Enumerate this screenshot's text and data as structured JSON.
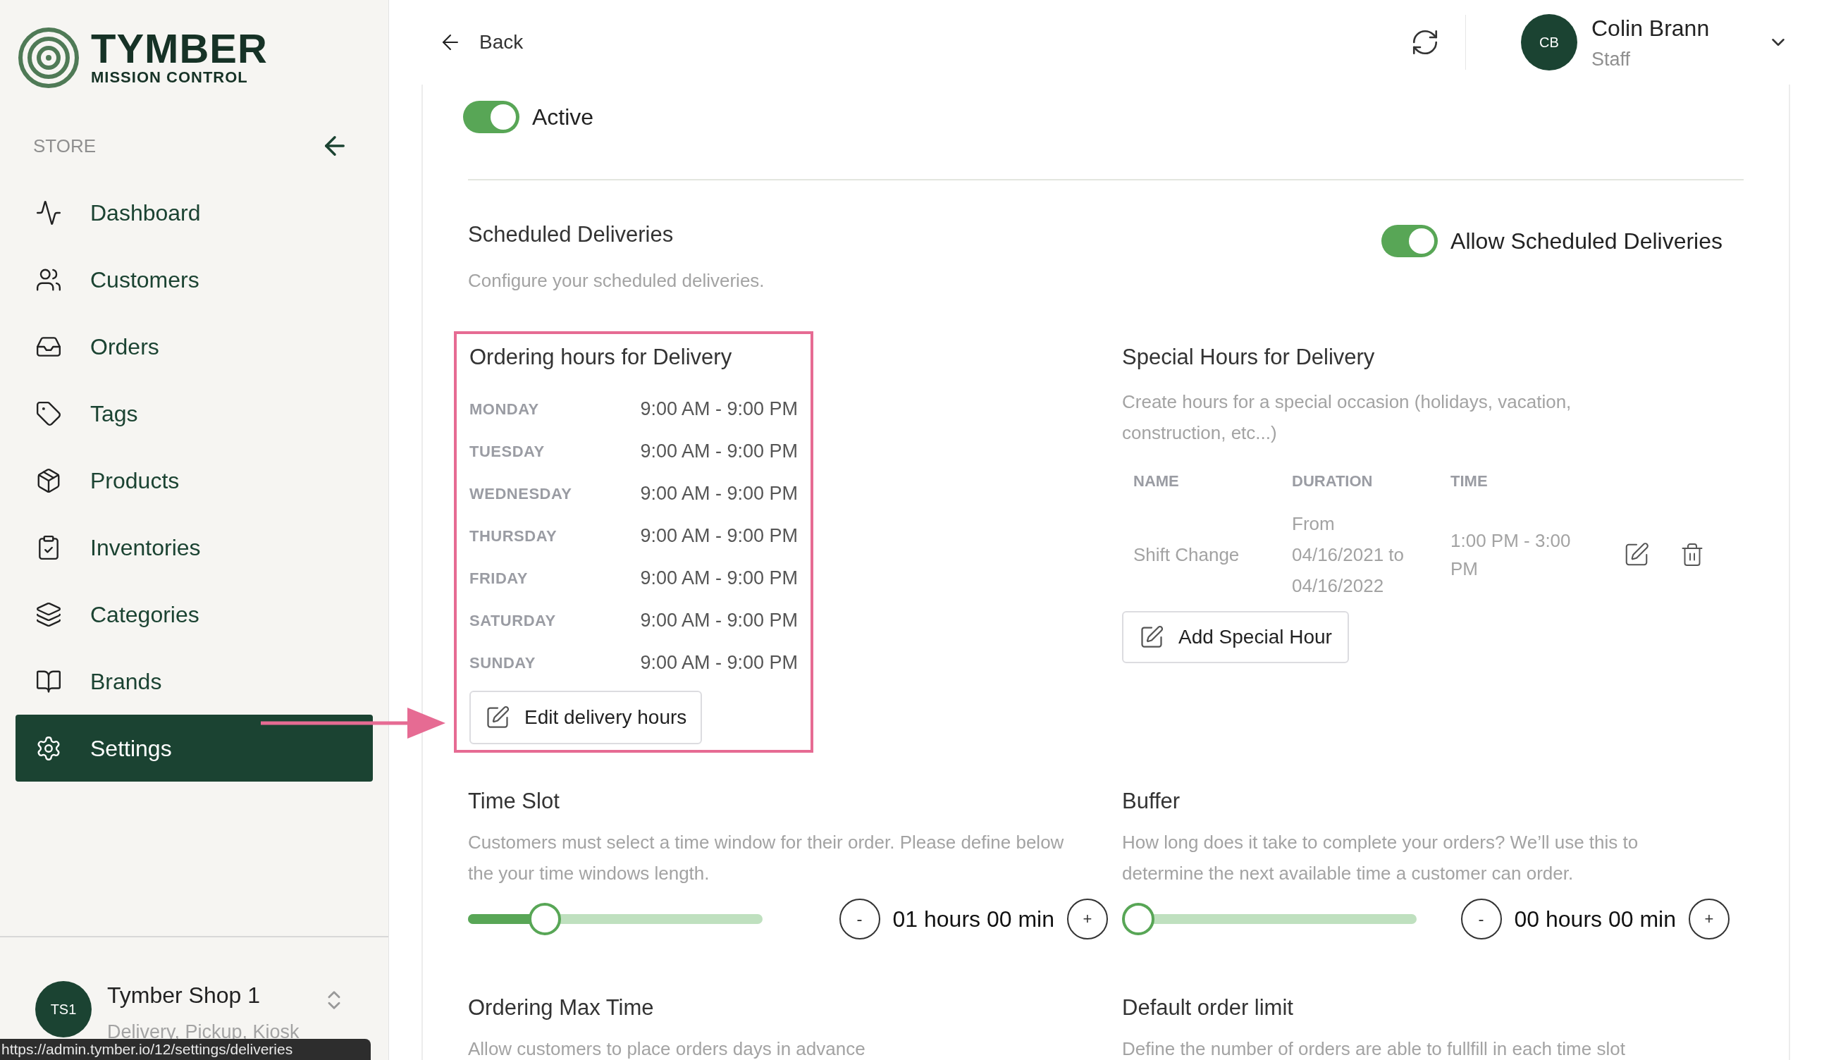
{
  "brand": {
    "name": "TYMBER",
    "tagline": "MISSION CONTROL"
  },
  "sidebar": {
    "section": "STORE",
    "items": [
      {
        "label": "Dashboard",
        "selected": false
      },
      {
        "label": "Customers",
        "selected": false
      },
      {
        "label": "Orders",
        "selected": false
      },
      {
        "label": "Tags",
        "selected": false
      },
      {
        "label": "Products",
        "selected": false
      },
      {
        "label": "Inventories",
        "selected": false
      },
      {
        "label": "Categories",
        "selected": false
      },
      {
        "label": "Brands",
        "selected": false
      },
      {
        "label": "Settings",
        "selected": true
      }
    ]
  },
  "shop": {
    "initials": "TS1",
    "name": "Tymber Shop 1",
    "channels": "Delivery, Pickup, Kiosk"
  },
  "status_url": "https://admin.tymber.io/12/settings/deliveries",
  "header": {
    "back": "Back",
    "user": {
      "initials": "CB",
      "name": "Colin Brann",
      "role": "Staff"
    }
  },
  "active_toggle": {
    "label": "Active",
    "on": true
  },
  "scheduled": {
    "title": "Scheduled Deliveries",
    "description": "Configure your scheduled deliveries.",
    "toggle": {
      "label": "Allow Scheduled Deliveries",
      "on": true
    }
  },
  "ordering_hours": {
    "title": "Ordering hours for Delivery",
    "highlighted": true,
    "button": "Edit delivery hours",
    "days": [
      {
        "day": "MONDAY",
        "hours": "9:00 AM - 9:00 PM"
      },
      {
        "day": "TUESDAY",
        "hours": "9:00 AM - 9:00 PM"
      },
      {
        "day": "WEDNESDAY",
        "hours": "9:00 AM - 9:00 PM"
      },
      {
        "day": "THURSDAY",
        "hours": "9:00 AM - 9:00 PM"
      },
      {
        "day": "FRIDAY",
        "hours": "9:00 AM - 9:00 PM"
      },
      {
        "day": "SATURDAY",
        "hours": "9:00 AM - 9:00 PM"
      },
      {
        "day": "SUNDAY",
        "hours": "9:00 AM - 9:00 PM"
      }
    ]
  },
  "special_hours": {
    "title": "Special Hours for Delivery",
    "description": "Create hours for a special occasion (holidays, vacation, construction, etc...)",
    "columns": [
      "NAME",
      "DURATION",
      "TIME"
    ],
    "rows": [
      {
        "name": "Shift Change",
        "duration": "From 04/16/2021 to 04/16/2022",
        "time": "1:00 PM - 3:00 PM"
      }
    ],
    "button": "Add Special Hour"
  },
  "settings": [
    {
      "title": "Time Slot",
      "description": "Customers must select a time window for their order. Please define below the your time windows length.",
      "level": 0.23,
      "value": "01 hours 00 min",
      "minus": "-",
      "plus": "+"
    },
    {
      "title": "Buffer",
      "description": "How long does it take to complete your orders? We’ll use this to determine the next available time a customer can order.",
      "level": 0,
      "value": "00 hours 00 min",
      "minus": "-",
      "plus": "+"
    }
  ],
  "more": [
    {
      "title": "Ordering Max Time",
      "description": "Allow customers to place orders days in advance"
    },
    {
      "title": "Default order limit",
      "description": "Define the number of orders are able to fullfill in each time slot"
    }
  ]
}
